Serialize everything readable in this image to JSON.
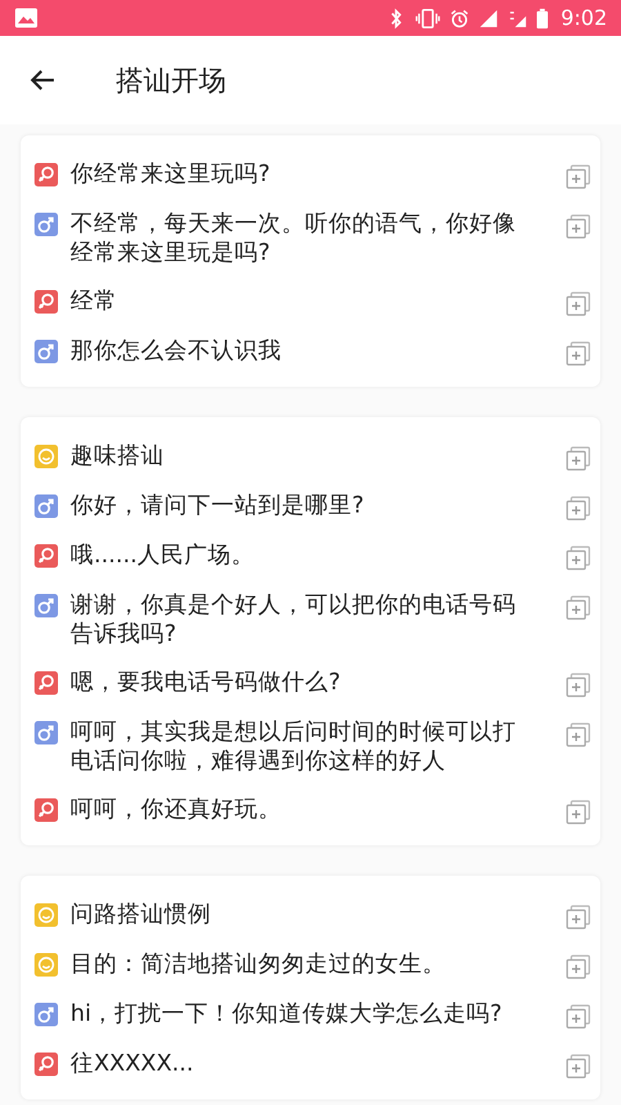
{
  "status_bar": {
    "time": "9:02"
  },
  "app_bar": {
    "title": "搭讪开场"
  },
  "cards": [
    {
      "rows": [
        {
          "kind": "female",
          "text": "你经常来这里玩吗?"
        },
        {
          "kind": "male",
          "text": "不经常，每天来一次。听你的语气，你好像经常来这里玩是吗?"
        },
        {
          "kind": "female",
          "text": "经常"
        },
        {
          "kind": "male",
          "text": "那你怎么会不认识我"
        }
      ]
    },
    {
      "rows": [
        {
          "kind": "tip",
          "text": "趣味搭讪"
        },
        {
          "kind": "male",
          "text": "你好，请问下一站到是哪里?"
        },
        {
          "kind": "female",
          "text": "哦......人民广场。"
        },
        {
          "kind": "male",
          "text": "谢谢，你真是个好人，可以把你的电话号码告诉我吗?"
        },
        {
          "kind": "female",
          "text": "嗯，要我电话号码做什么?"
        },
        {
          "kind": "male",
          "text": "呵呵，其实我是想以后问时间的时候可以打电话问你啦，难得遇到你这样的好人"
        },
        {
          "kind": "female",
          "text": "呵呵，你还真好玩。"
        }
      ]
    },
    {
      "rows": [
        {
          "kind": "tip",
          "text": "问路搭讪惯例"
        },
        {
          "kind": "tip",
          "text": "目的：简洁地搭讪匆匆走过的女生。"
        },
        {
          "kind": "male",
          "text": "hi，打扰一下！你知道传媒大学怎么走吗?"
        },
        {
          "kind": "female",
          "text": "往XXXXX..."
        }
      ]
    }
  ]
}
